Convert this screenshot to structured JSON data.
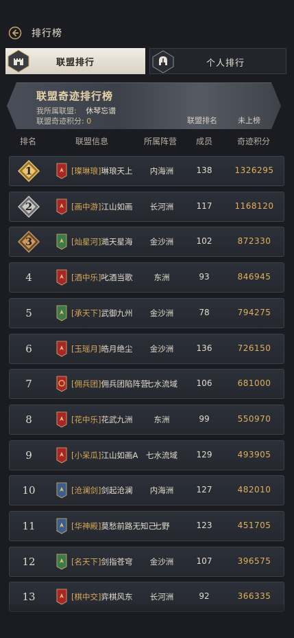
{
  "header": {
    "title": "排行榜",
    "back_icon": "back-arrow-icon"
  },
  "tabs": [
    {
      "label": "联盟排行",
      "icon": "castle-icon",
      "active": true
    },
    {
      "label": "个人排行",
      "icon": "helmet-icon",
      "active": false
    }
  ],
  "banner": {
    "title": "联盟奇迹排行榜",
    "my_alliance_label": "我所属联盟:",
    "my_alliance_value": "休琴忘谱",
    "score_label": "联盟奇迹积分:",
    "score_value": "0",
    "rank_label": "联盟排名",
    "rank_value": "未上榜"
  },
  "columns": {
    "rank": "排名",
    "info": "联盟信息",
    "camp": "所属阵营",
    "members": "成员",
    "score": "奇迹积分"
  },
  "colors": {
    "gold": "#e0b15c",
    "tag": "#d8a957",
    "bg": "#1b1c21"
  },
  "rows": [
    {
      "rank": "1",
      "medal": "gold",
      "flag": "red",
      "tag": "[璨琳琅]",
      "name": "琳琅天上",
      "camp": "内海洲",
      "members": "138",
      "score": "1326295"
    },
    {
      "rank": "2",
      "medal": "silver",
      "flag": "red",
      "tag": "[画中游]",
      "name": "江山如画",
      "camp": "长河洲",
      "members": "117",
      "score": "1168120"
    },
    {
      "rank": "3",
      "medal": "bronze",
      "flag": "green",
      "tag": "[灿星河]",
      "name": "澔天星海",
      "camp": "金沙洲",
      "members": "102",
      "score": "872330"
    },
    {
      "rank": "4",
      "medal": "",
      "flag": "red",
      "tag": "[酒中乐]",
      "name": "叱酒当歌",
      "camp": "东洲",
      "members": "93",
      "score": "846945"
    },
    {
      "rank": "5",
      "medal": "",
      "flag": "green",
      "tag": "[承天下]",
      "name": "武御九州",
      "camp": "金沙洲",
      "members": "78",
      "score": "794275"
    },
    {
      "rank": "6",
      "medal": "",
      "flag": "red",
      "tag": "[玉瑶月]",
      "name": "皓月绝尘",
      "camp": "金沙洲",
      "members": "136",
      "score": "726150"
    },
    {
      "rank": "7",
      "medal": "",
      "flag": "red-ring",
      "tag": "[佣兵团]",
      "name": "佣兵团陷阵营",
      "camp": "七水流域",
      "members": "106",
      "score": "681000"
    },
    {
      "rank": "8",
      "medal": "",
      "flag": "red",
      "tag": "[花中乐]",
      "name": "花武九洲",
      "camp": "东洲",
      "members": "99",
      "score": "550970"
    },
    {
      "rank": "9",
      "medal": "",
      "flag": "red",
      "tag": "[小呆瓜]",
      "name": "江山如画A",
      "camp": "七水流域",
      "members": "129",
      "score": "493905"
    },
    {
      "rank": "10",
      "medal": "",
      "flag": "blue",
      "tag": "[沧澜剑]",
      "name": "剑起沧澜",
      "camp": "内海洲",
      "members": "127",
      "score": "482010"
    },
    {
      "rank": "11",
      "medal": "",
      "flag": "blue",
      "tag": "[华神殿]",
      "name": "莫愁前路无知己",
      "camp": "七野",
      "members": "123",
      "score": "451705"
    },
    {
      "rank": "12",
      "medal": "",
      "flag": "green",
      "tag": "[名天下]",
      "name": "剑指苍穹",
      "camp": "金沙洲",
      "members": "107",
      "score": "396575"
    },
    {
      "rank": "13",
      "medal": "",
      "flag": "red",
      "tag": "[棋中交]",
      "name": "弈棋风东",
      "camp": "长河洲",
      "members": "92",
      "score": "366335"
    }
  ]
}
